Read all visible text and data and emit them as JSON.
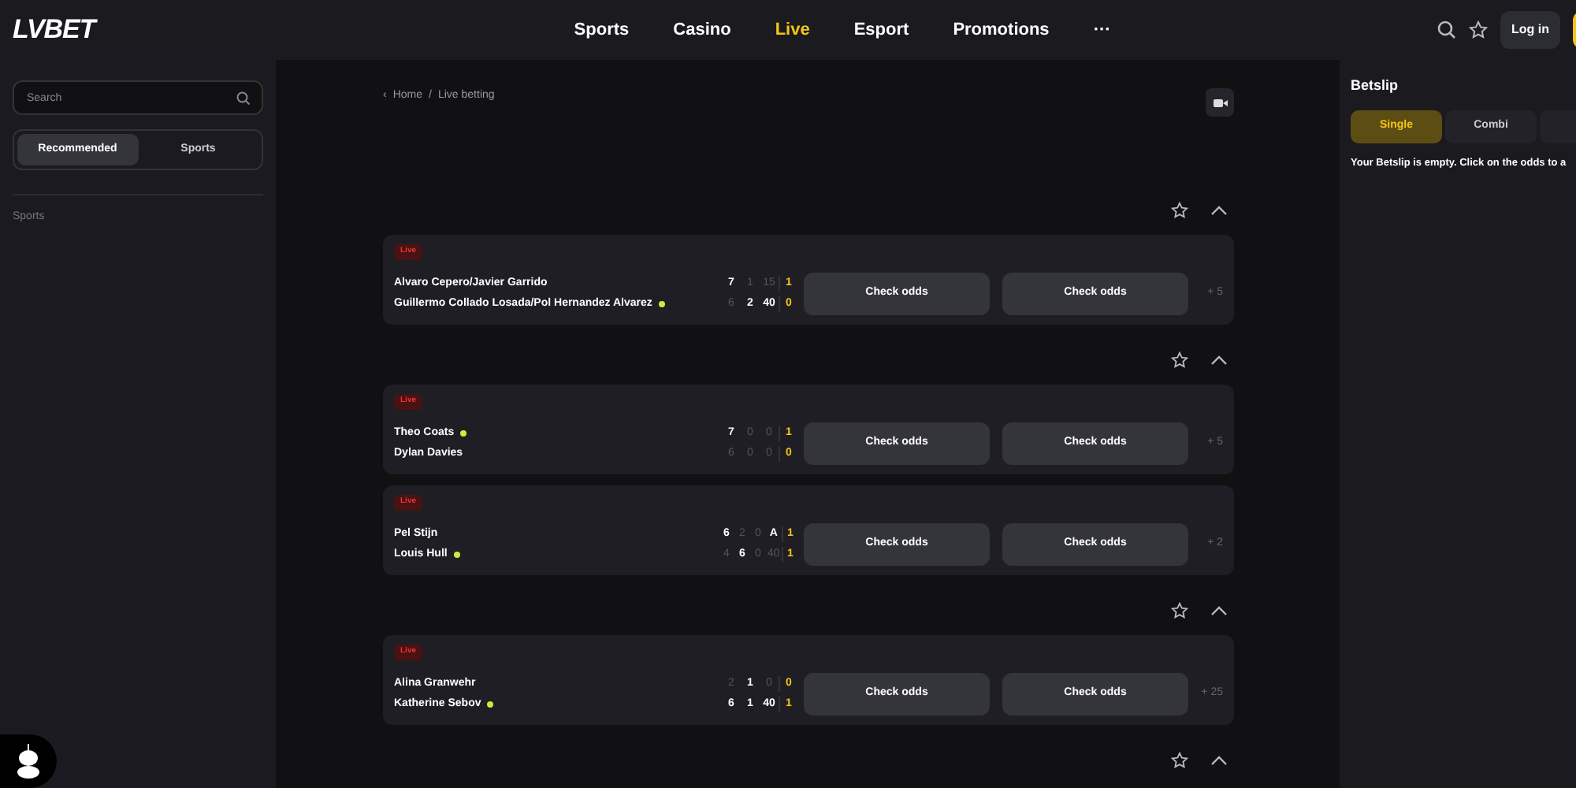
{
  "header": {
    "logo": "LVBET",
    "nav": [
      {
        "label": "Sports",
        "selected": false
      },
      {
        "label": "Casino",
        "selected": false
      },
      {
        "label": "Live",
        "selected": true
      },
      {
        "label": "Esport",
        "selected": false
      },
      {
        "label": "Promotions",
        "selected": false
      },
      {
        "label": "···",
        "selected": false
      }
    ],
    "login": "Log in"
  },
  "sidebar": {
    "search": {
      "placeholder": "Search"
    },
    "tabs": [
      {
        "label": "Recommended",
        "selected": true
      },
      {
        "label": "Sports",
        "selected": false
      }
    ],
    "section": "Sports"
  },
  "breadcrumb": {
    "back": "‹",
    "separator": "/",
    "items": [
      "Home",
      "Live betting"
    ]
  },
  "groups": [
    {
      "matches": [
        {
          "badge": "Live",
          "more": "+ 5",
          "odds": [
            "Check odds",
            "Check odds"
          ],
          "players": [
            {
              "name": "Alvaro Cepero/Javier Garrido",
              "serving": false,
              "scores": [
                {
                  "value": "7",
                  "lit": true
                },
                {
                  "value": "1",
                  "lit": false
                },
                {
                  "value": "15",
                  "lit": false
                },
                {
                  "value": "1",
                  "lit": true
                }
              ]
            },
            {
              "name": "Guillermo Collado Losada/Pol Hernandez Alvarez",
              "serving": true,
              "scores": [
                {
                  "value": "6",
                  "lit": false
                },
                {
                  "value": "2",
                  "lit": true
                },
                {
                  "value": "40",
                  "lit": true
                },
                {
                  "value": "0",
                  "lit": true
                }
              ]
            }
          ]
        }
      ]
    },
    {
      "matches": [
        {
          "badge": "Live",
          "more": "+ 5",
          "odds": [
            "Check odds",
            "Check odds"
          ],
          "players": [
            {
              "name": "Theo Coats",
              "serving": true,
              "scores": [
                {
                  "value": "7",
                  "lit": true
                },
                {
                  "value": "0",
                  "lit": false
                },
                {
                  "value": "0",
                  "lit": false
                },
                {
                  "value": "1",
                  "lit": true
                }
              ]
            },
            {
              "name": "Dylan Davies",
              "serving": false,
              "scores": [
                {
                  "value": "6",
                  "lit": false
                },
                {
                  "value": "0",
                  "lit": false
                },
                {
                  "value": "0",
                  "lit": false
                },
                {
                  "value": "0",
                  "lit": true
                }
              ]
            }
          ]
        },
        {
          "badge": "Live",
          "more": "+ 2",
          "odds": [
            "Check odds",
            "Check odds"
          ],
          "players": [
            {
              "name": "Pel Stijn",
              "serving": false,
              "scores": [
                {
                  "value": "6",
                  "lit": true
                },
                {
                  "value": "2",
                  "lit": false
                },
                {
                  "value": "0",
                  "lit": false
                },
                {
                  "value": "A",
                  "lit": true
                },
                {
                  "value": "1",
                  "lit": true
                }
              ]
            },
            {
              "name": "Louis Hull",
              "serving": true,
              "scores": [
                {
                  "value": "4",
                  "lit": false
                },
                {
                  "value": "6",
                  "lit": true
                },
                {
                  "value": "0",
                  "lit": false
                },
                {
                  "value": "40",
                  "lit": false
                },
                {
                  "value": "1",
                  "lit": true
                }
              ]
            }
          ]
        }
      ]
    },
    {
      "matches": [
        {
          "badge": "Live",
          "more": "+ 25",
          "odds": [
            "Check odds",
            "Check odds"
          ],
          "players": [
            {
              "name": "Alina Granwehr",
              "serving": false,
              "scores": [
                {
                  "value": "2",
                  "lit": false
                },
                {
                  "value": "1",
                  "lit": true
                },
                {
                  "value": "0",
                  "lit": false
                },
                {
                  "value": "0",
                  "lit": true
                }
              ]
            },
            {
              "name": "Katherine Sebov",
              "serving": true,
              "scores": [
                {
                  "value": "6",
                  "lit": true
                },
                {
                  "value": "1",
                  "lit": true
                },
                {
                  "value": "40",
                  "lit": true
                },
                {
                  "value": "1",
                  "lit": true
                }
              ]
            }
          ]
        }
      ]
    },
    {
      "collapsible": true
    }
  ],
  "betslip": {
    "title": "Betslip",
    "tabs": [
      {
        "label": "Single",
        "selected": true
      },
      {
        "label": "Combi",
        "selected": false
      },
      {
        "selected": false
      }
    ],
    "message": "Your Betslip is empty. Click on the odds to a"
  }
}
